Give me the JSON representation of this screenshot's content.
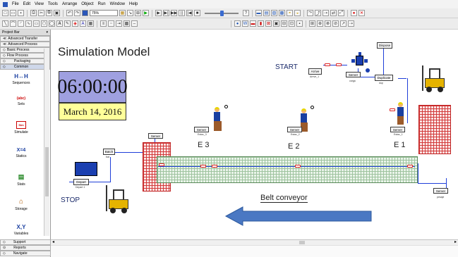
{
  "menu": {
    "items": [
      "File",
      "Edit",
      "View",
      "Tools",
      "Arrange",
      "Object",
      "Run",
      "Window",
      "Help"
    ]
  },
  "toolbar": {
    "zoom_value": "75%"
  },
  "project_bar": {
    "title": "Project Bar",
    "title_pin": "▾",
    "panels": [
      {
        "label": "Advanced Transfer",
        "prefix": "≪"
      },
      {
        "label": "Advanced Process",
        "prefix": "≪"
      },
      {
        "label": "Basic Process",
        "prefix": "◇"
      },
      {
        "label": "Flow Process",
        "prefix": "◇"
      },
      {
        "label": "Packaging",
        "prefix": "◇"
      },
      {
        "label": "Common",
        "prefix": "◇"
      }
    ],
    "modules": [
      {
        "label": "Sequences",
        "icon": "sequences-icon",
        "glyph": "H↔H"
      },
      {
        "label": "Sets",
        "icon": "sets-icon",
        "glyph": "{abc}"
      },
      {
        "label": "Simulate",
        "icon": "simulate-icon",
        "glyph": "Sim"
      },
      {
        "label": "Statics",
        "icon": "statics-icon",
        "glyph": "X=4"
      },
      {
        "label": "Stats",
        "icon": "stats-icon",
        "glyph": "▤"
      },
      {
        "label": "Storage",
        "icon": "storage-icon",
        "glyph": "⌂"
      },
      {
        "label": "Variables",
        "icon": "variables-icon",
        "glyph": "X,Y"
      }
    ],
    "bottom": [
      {
        "label": "Support",
        "prefix": "◇"
      },
      {
        "label": "Reports",
        "prefix": "⊙"
      },
      {
        "label": "Navigate",
        "prefix": "◇"
      }
    ]
  },
  "canvas": {
    "title": "Simulation Model",
    "clock": "06:00:00",
    "date": "March 14, 2016",
    "start_label": "START",
    "stop_label": "STOP",
    "belt_label": "Belt conveyor",
    "stations": [
      "E 3",
      "E 2",
      "E 1"
    ],
    "modules": {
      "dispose": "Dispose",
      "arrive": "Arrive",
      "arrive_sub": "Arrive_1",
      "server_top": "Server",
      "server_top_sub": "carga",
      "duplicate": "Duplicate",
      "duplicate_sub": "dup",
      "server_left": "Server",
      "batch": "Batch",
      "batch_sub": "bat",
      "depart": "Depart",
      "depart_sub": "Depart 1",
      "server_e3": "Server",
      "server_e3_sub": "Estac_3",
      "server_e2": "Server",
      "server_e2_sub": "Estac_2",
      "server_e1": "Server",
      "server_e1_sub": "Estac_1",
      "server_right": "Server",
      "server_right_sub": "pesaje"
    }
  },
  "colors": {
    "clock_bg": "#9fa0e0",
    "date_bg": "#ffff99",
    "arrow_fill": "#4a78c3",
    "grid_red": "#d23a3a",
    "connector_blue": "#1f3fd9"
  }
}
